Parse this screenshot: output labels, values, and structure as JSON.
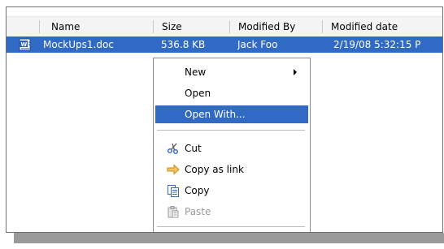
{
  "columns": {
    "name": "Name",
    "size": "Size",
    "modified_by": "Modified By",
    "modified_date": "Modified date"
  },
  "file": {
    "name": "MockUps1.doc",
    "size": "536.8 KB",
    "modified_by": "Jack Foo",
    "modified_date": "2/19/08 5:32:15 P",
    "icon": "word-doc-icon"
  },
  "context_menu": {
    "items": [
      {
        "label": "New",
        "submenu": true
      },
      {
        "label": "Open"
      },
      {
        "label": "Open With...",
        "highlighted": true
      },
      {
        "label": "Cut",
        "icon": "scissors-icon"
      },
      {
        "label": "Copy as link",
        "icon": "arrow-link-icon"
      },
      {
        "label": "Copy",
        "icon": "copy-icon"
      },
      {
        "label": "Paste",
        "icon": "paste-icon",
        "disabled": true
      }
    ]
  },
  "colors": {
    "selection": "#316ac5",
    "header_bg": "#f4f4f4"
  }
}
